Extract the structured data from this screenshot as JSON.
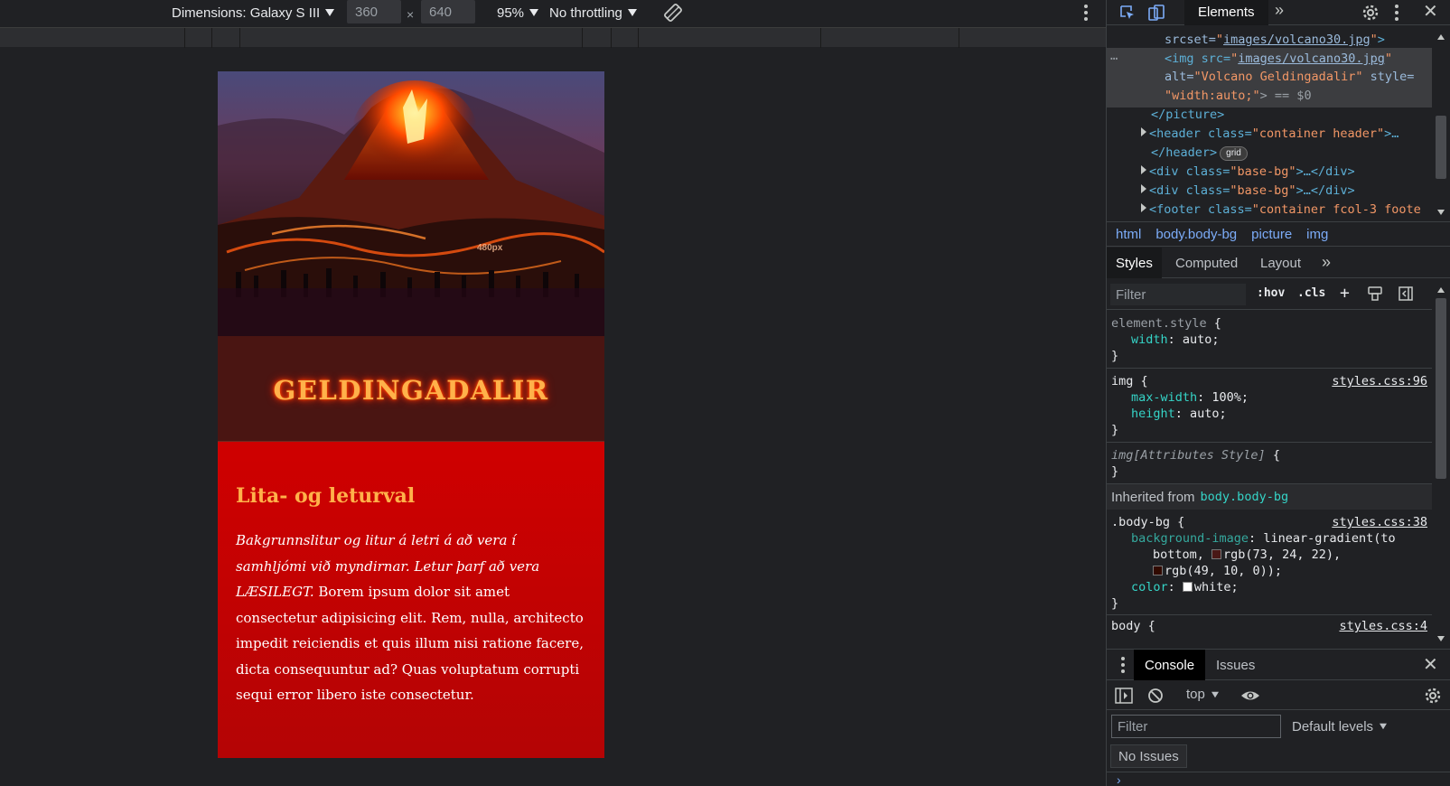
{
  "device_toolbar": {
    "dimensions_label": "Dimensions: Galaxy S III",
    "width_value": "360",
    "times": "×",
    "height_value": "640",
    "zoom": "95%",
    "throttling": "No throttling"
  },
  "page": {
    "hero_image_alt": "Volcano Geldingadalir",
    "hero_overlay_label": "480px",
    "site_title": "GELDINGADALIR",
    "section_heading": "Lita- og leturval",
    "paragraph_italic": "Bakgrunnslitur og litur á letri á að vera í samhljómi við myndirnar. Letur þarf að vera LÆSILEGT.",
    "paragraph_normal": " Borem ipsum dolor sit amet consectetur adipisicing elit. Rem, nulla, architecto impedit reiciendis et quis illum nisi ratione facere, dicta consequuntur ad? Quas voluptatum corrupti sequi error libero iste consectetur."
  },
  "devtools": {
    "active_tab": "Elements",
    "dom": {
      "line_srcset_attr": "srcset=",
      "line_srcset_val": "images/volcano30.jpg",
      "line_img_tag": "<img src=",
      "line_img_src": "images/volcano30.jpg",
      "line_img_alt_attr": "alt=",
      "line_img_alt_val": "\"Volcano Geldingadalir\"",
      "line_img_style_attr": " style=",
      "line_img_style_val": "\"width:auto;\"",
      "line_img_end": "> == $0",
      "line_picture_close": "</picture>",
      "line_header_open": "<header class=",
      "line_header_class": "\"container header\"",
      "line_header_rest": ">…",
      "line_header_close": "</header>",
      "grid_badge": "grid",
      "line_div1": "<div class=",
      "line_div1_class": "\"base-bg\"",
      "line_div1_rest": ">…</div>",
      "line_div2": "<div class=",
      "line_div2_class": "\"base-bg\"",
      "line_div2_rest": ">…</div>",
      "line_footer": "<footer class=",
      "line_footer_class": "\"container fcol-3 foote"
    },
    "breadcrumb": [
      "html",
      "body.body-bg",
      "picture",
      "img"
    ],
    "styles_tabs": [
      "Styles",
      "Computed",
      "Layout"
    ],
    "filter_placeholder": "Filter",
    "hov": ":hov",
    "cls": ".cls",
    "rules": {
      "element_style_selector": "element.style",
      "element_style_prop": "width",
      "element_style_val": "auto;",
      "img_selector": "img",
      "img_source": "styles.css:96",
      "img_prop1": "max-width",
      "img_val1": "100%;",
      "img_prop2": "height",
      "img_val2": "auto;",
      "attr_style_selector": "img[Attributes Style]",
      "inherited_label": "Inherited from",
      "inherited_from": "body.body-bg",
      "bodybg_selector": ".body-bg",
      "bodybg_source": "styles.css:38",
      "bodybg_prop1": "background-image",
      "bodybg_val1a": "linear-gradient(to",
      "bodybg_val1b": "bottom,",
      "bodybg_val1c": "rgb(73, 24, 22),",
      "bodybg_val1d": "rgb(49, 10, 0));",
      "bodybg_prop2": "color",
      "bodybg_val2": "white;",
      "body_selector": "body",
      "body_source": "styles.css:4"
    },
    "console": {
      "tabs": [
        "Console",
        "Issues"
      ],
      "context": "top",
      "filter_placeholder": "Filter",
      "levels": "Default levels",
      "no_issues": "No Issues",
      "prompt": "›"
    },
    "colors": {
      "swatch_1": "#491816",
      "swatch_2": "#310a00",
      "swatch_3": "#ffffff"
    }
  }
}
